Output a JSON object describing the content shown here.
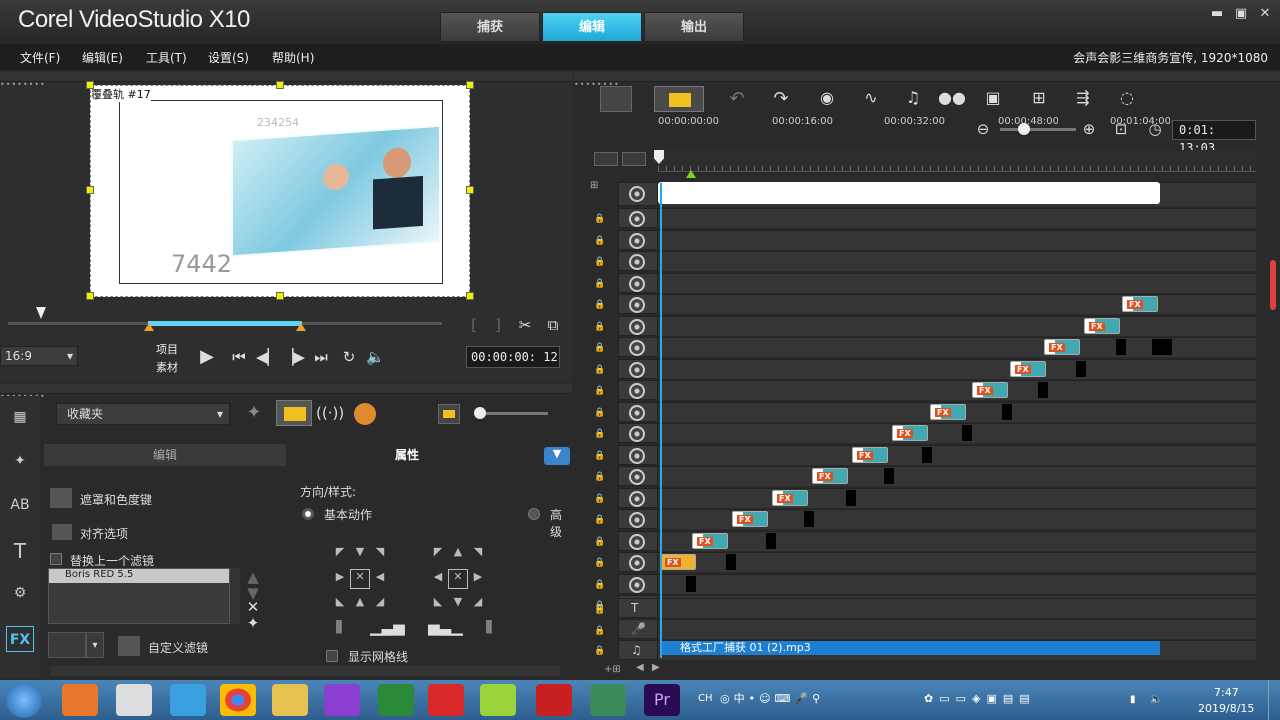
{
  "app": {
    "title": "Corel VideoStudio X10"
  },
  "tabs": [
    {
      "label": "捕获"
    },
    {
      "label": "编辑"
    },
    {
      "label": "输出"
    }
  ],
  "menu": [
    {
      "label": "文件(F)"
    },
    {
      "label": "编辑(E)"
    },
    {
      "label": "工具(T)"
    },
    {
      "label": "设置(S)"
    },
    {
      "label": "帮助(H)"
    }
  ],
  "project_info": "会声会影三维商务宣传, 1920*1080",
  "preview": {
    "overlay_label": "覆叠轨 #17",
    "number_small": "234254",
    "number_large": "7442",
    "aspect": "16:9",
    "mode_project": "项目",
    "mode_clip": "素材",
    "timecode": "00:00:00: 12"
  },
  "timeline": {
    "ruler": [
      "00:00:00:00",
      "00:00:16:00",
      "00:00:32:00",
      "00:00:48:00",
      "00:01:04:00"
    ],
    "duration": "0:01: 13:03",
    "audio_clip": "格式工厂捕获 01 (2).mp3"
  },
  "library": {
    "dropdown": "收藏夹",
    "tabs": [
      {
        "label": "编辑"
      },
      {
        "label": "属性"
      }
    ],
    "mask_chroma": "遮罩和色度键",
    "align_options": "对齐选项",
    "replace_filter": "替换上一个滤镜",
    "filter_item": "Boris RED 5.5",
    "custom_filter": "自定义滤镜",
    "direction_style": "方向/样式:",
    "basic_motion": "基本动作",
    "advanced": "高级",
    "show_grid": "显示网格线"
  },
  "taskbar": {
    "time": "7:47",
    "date": "2019/8/15",
    "lang": "CH"
  },
  "colors": {
    "accent": "#1fa8d8",
    "clip_fx": "#e05020",
    "audio": "#1c7fd1"
  }
}
